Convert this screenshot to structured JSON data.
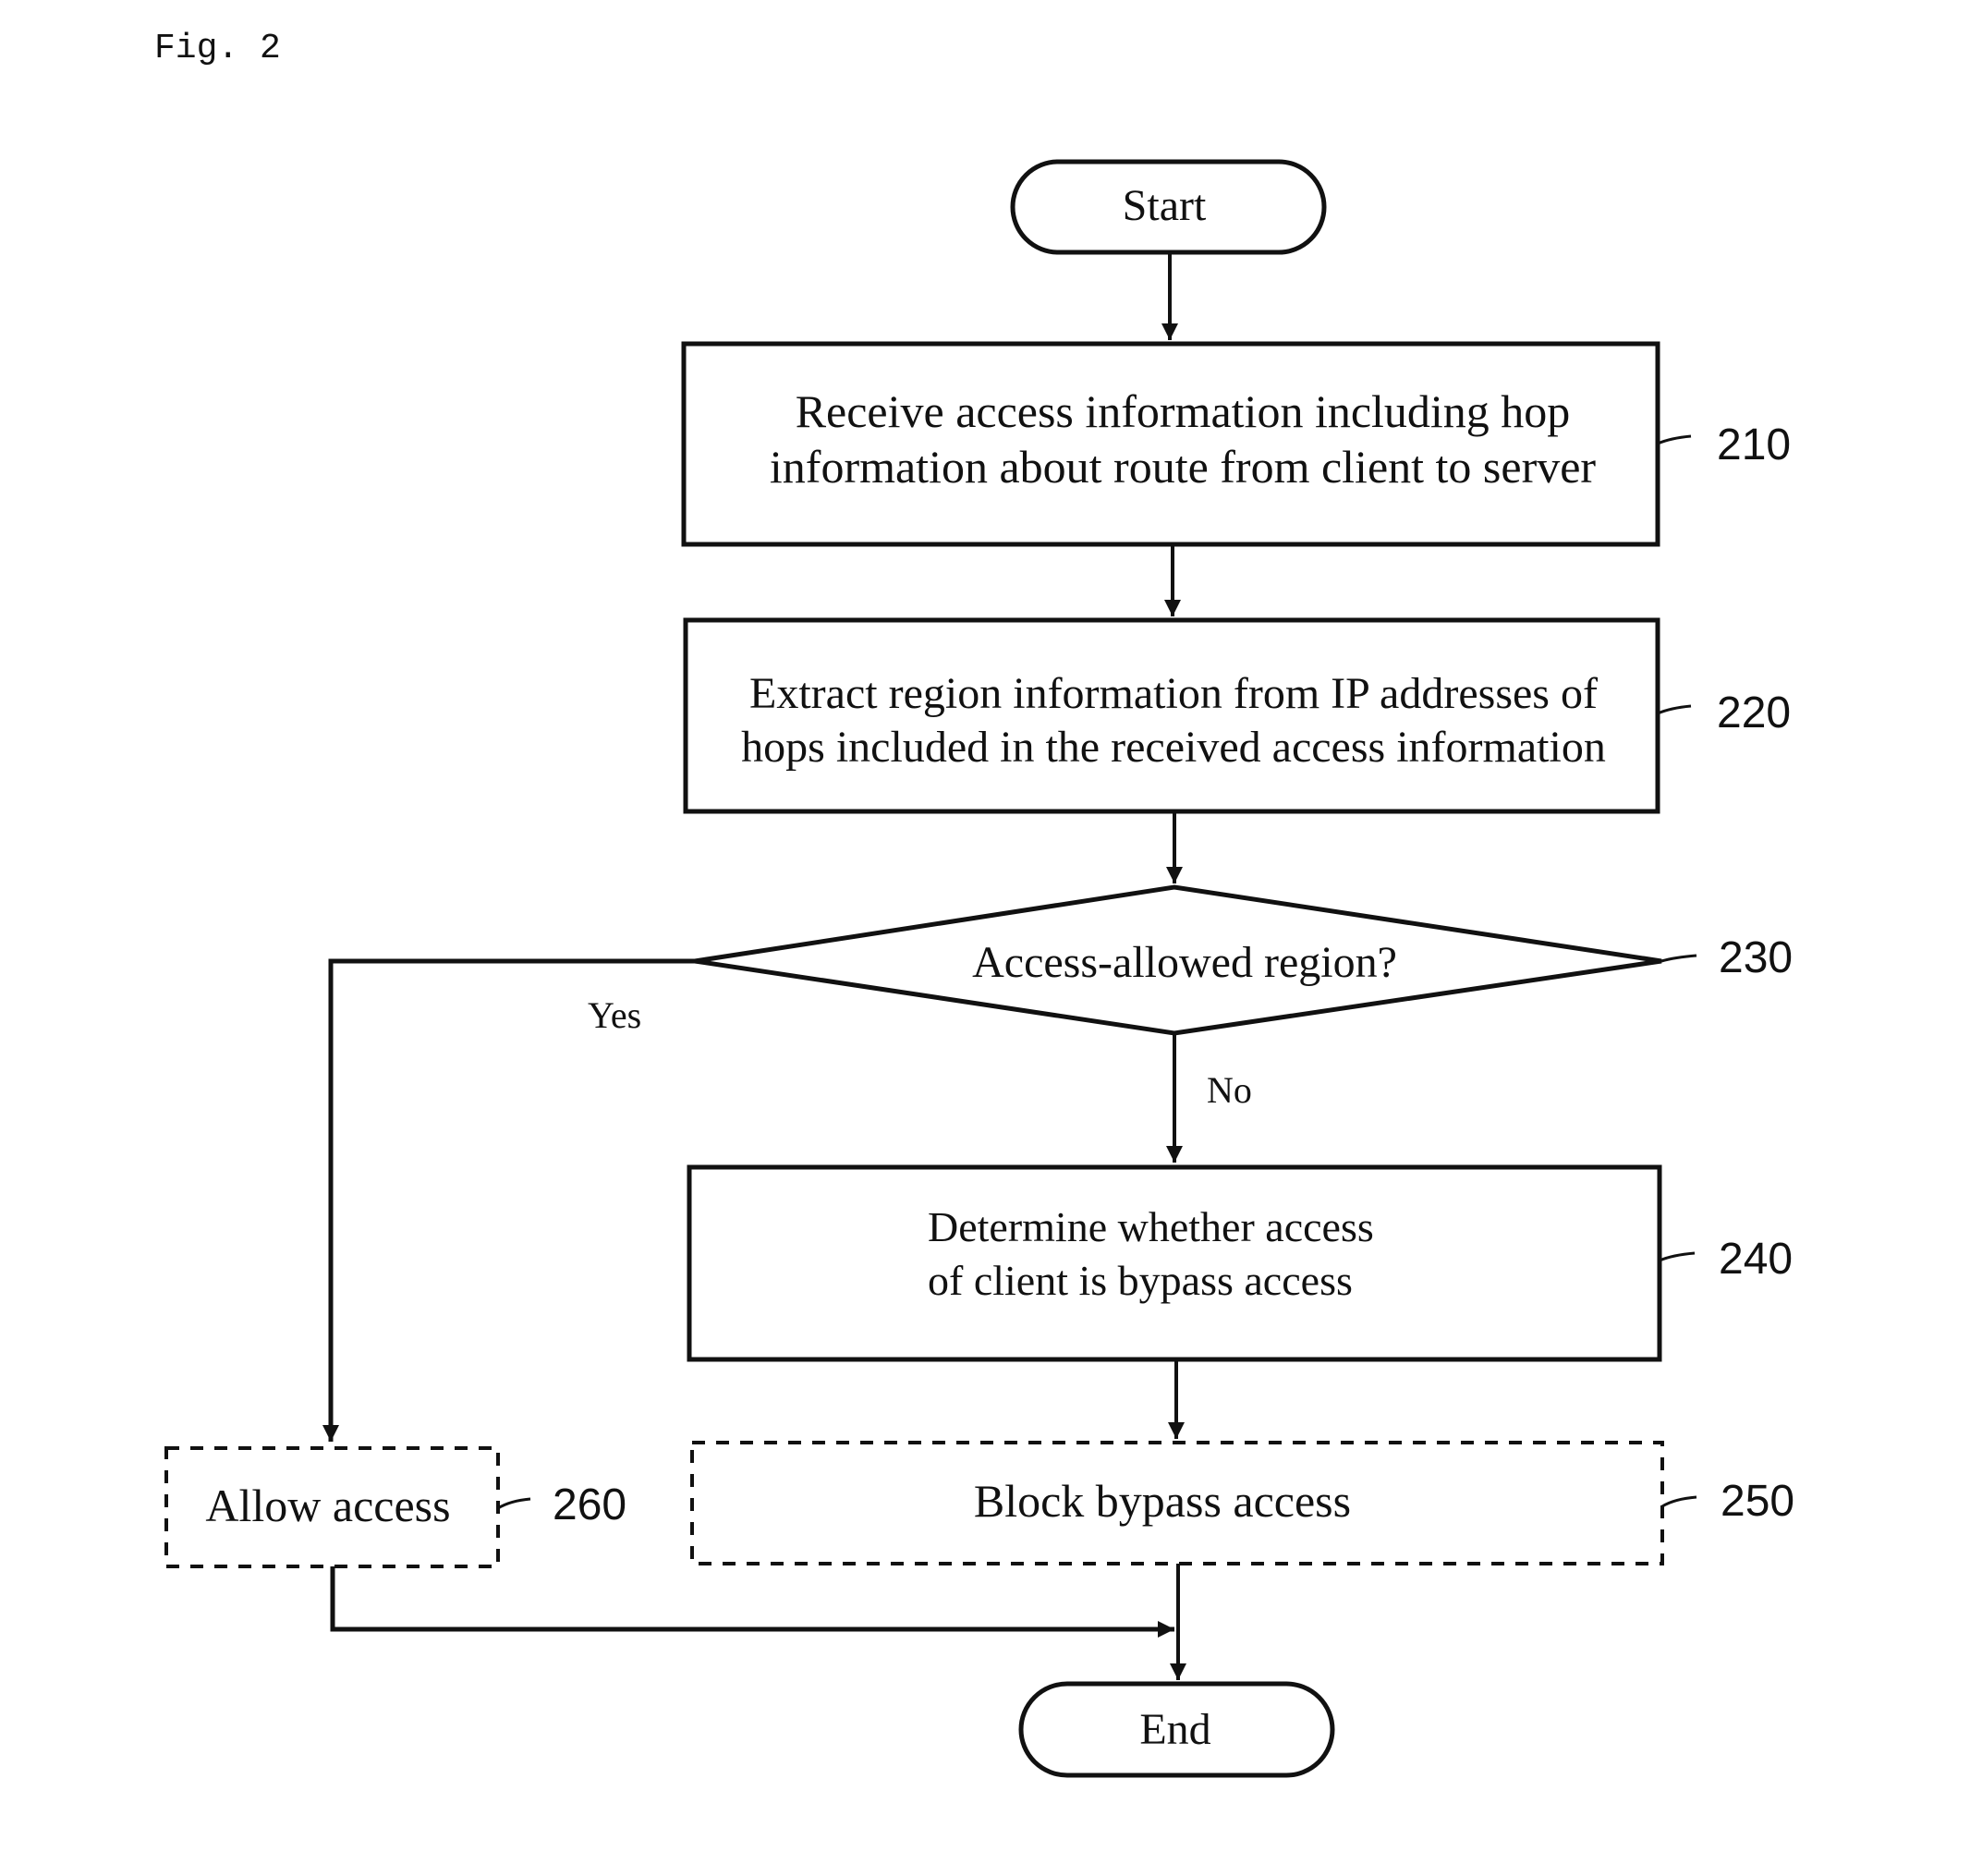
{
  "figure": {
    "label": "Fig. 2"
  },
  "nodes": {
    "start": {
      "text": "Start"
    },
    "s210": {
      "ref": "210",
      "lines": [
        "Receive access information including hop",
        "information about route from client to server"
      ]
    },
    "s220": {
      "ref": "220",
      "lines": [
        "Extract region information from IP addresses of",
        "hops included in the received access information"
      ]
    },
    "s230": {
      "ref": "230",
      "text": "Access-allowed region?"
    },
    "s240": {
      "ref": "240",
      "lines": [
        "Determine whether access",
        "of client is bypass access"
      ]
    },
    "s250": {
      "ref": "250",
      "text": "Block bypass access"
    },
    "s260": {
      "ref": "260",
      "text": "Allow access"
    },
    "end": {
      "text": "End"
    }
  },
  "edges": {
    "yes_label": "Yes",
    "no_label": "No"
  }
}
